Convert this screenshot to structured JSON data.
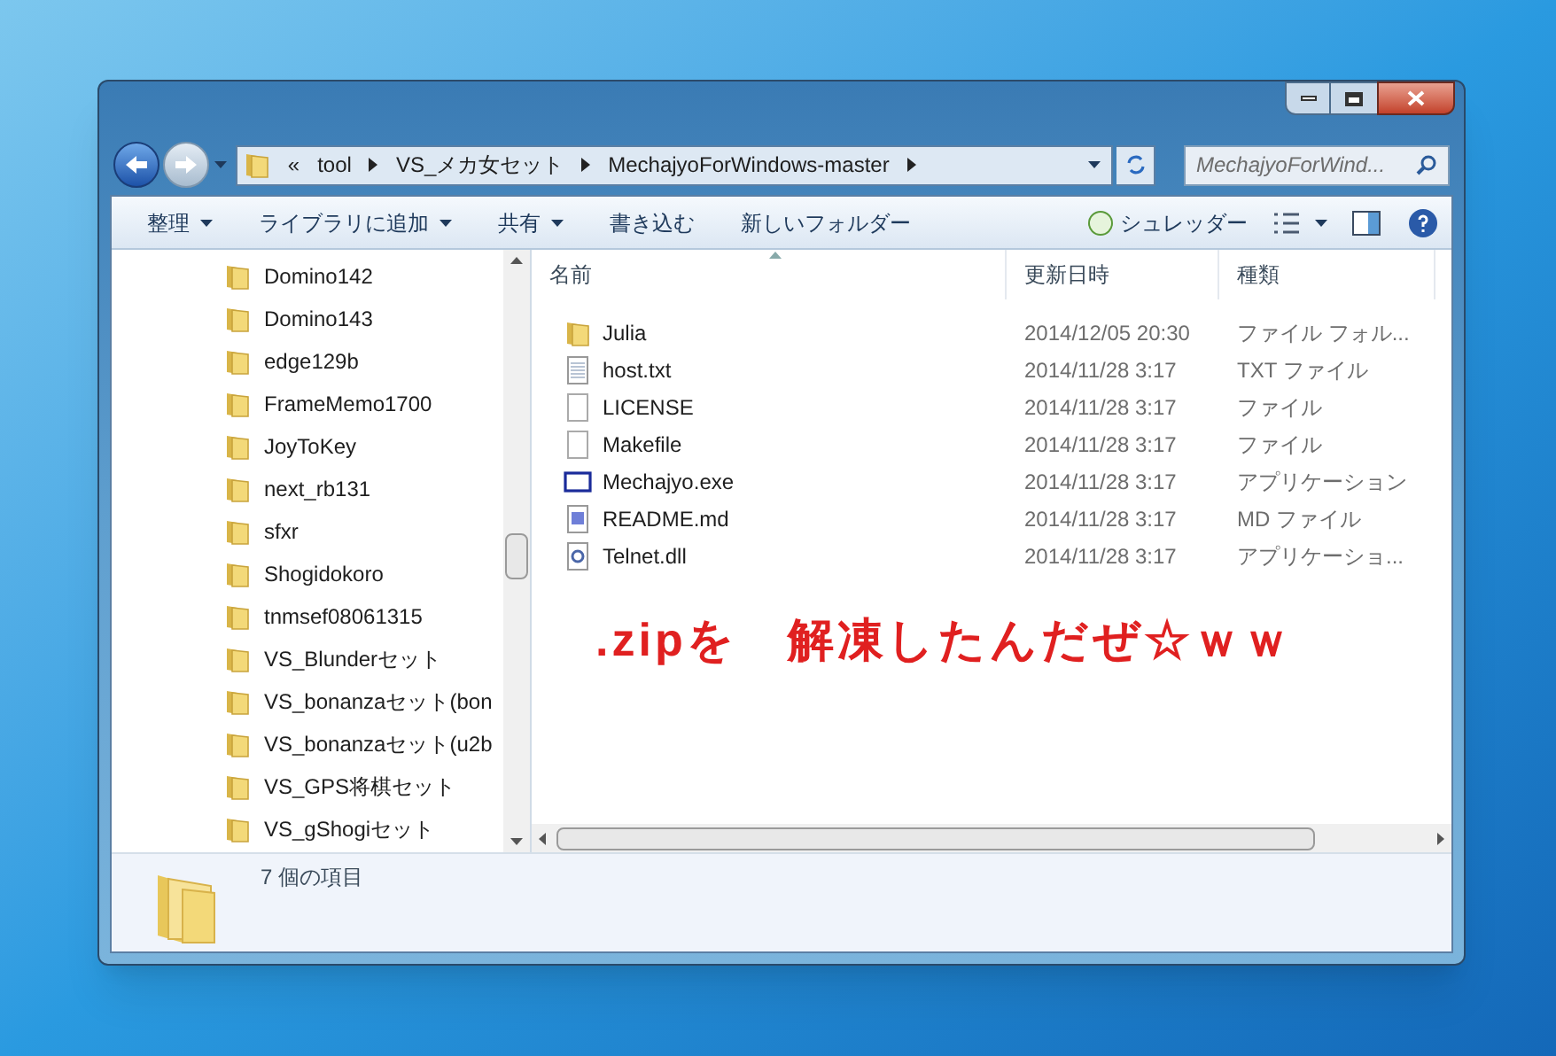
{
  "address_bar": {
    "overflow": "«",
    "crumbs": [
      "tool",
      "VS_メカ女セット",
      "MechajyoForWindows-master"
    ]
  },
  "search": {
    "placeholder": "MechajyoForWind..."
  },
  "toolbar": {
    "items": [
      {
        "label": "整理",
        "dropdown": true
      },
      {
        "label": "ライブラリに追加",
        "dropdown": true
      },
      {
        "label": "共有",
        "dropdown": true
      },
      {
        "label": "書き込む",
        "dropdown": false
      },
      {
        "label": "新しいフォルダー",
        "dropdown": false
      }
    ],
    "shredder": "シュレッダー"
  },
  "navigation": {
    "items": [
      "Domino142",
      "Domino143",
      "edge129b",
      "FrameMemo1700",
      "JoyToKey",
      "next_rb131",
      "sfxr",
      "Shogidokoro",
      "tnmsef08061315",
      "VS_Blunderセット",
      "VS_bonanzaセット(bon",
      "VS_bonanzaセット(u2b",
      "VS_GPS将棋セット",
      "VS_gShogiセット"
    ]
  },
  "table": {
    "columns": [
      "名前",
      "更新日時",
      "種類"
    ],
    "rows": [
      {
        "kind": "folder",
        "name": "Julia",
        "date": "2014/12/05 20:30",
        "type": "ファイル フォル..."
      },
      {
        "kind": "text",
        "name": "host.txt",
        "date": "2014/11/28 3:17",
        "type": "TXT ファイル"
      },
      {
        "kind": "blank",
        "name": "LICENSE",
        "date": "2014/11/28 3:17",
        "type": "ファイル"
      },
      {
        "kind": "blank",
        "name": "Makefile",
        "date": "2014/11/28 3:17",
        "type": "ファイル"
      },
      {
        "kind": "exe",
        "name": "Mechajyo.exe",
        "date": "2014/11/28 3:17",
        "type": "アプリケーション"
      },
      {
        "kind": "doc",
        "name": "README.md",
        "date": "2014/11/28 3:17",
        "type": "MD ファイル"
      },
      {
        "kind": "dll",
        "name": "Telnet.dll",
        "date": "2014/11/28 3:17",
        "type": "アプリケーショ..."
      }
    ]
  },
  "annotation": ".zipを　解凍したんだぜ☆ｗｗ",
  "status_bar": {
    "count": "7 個の項目"
  }
}
